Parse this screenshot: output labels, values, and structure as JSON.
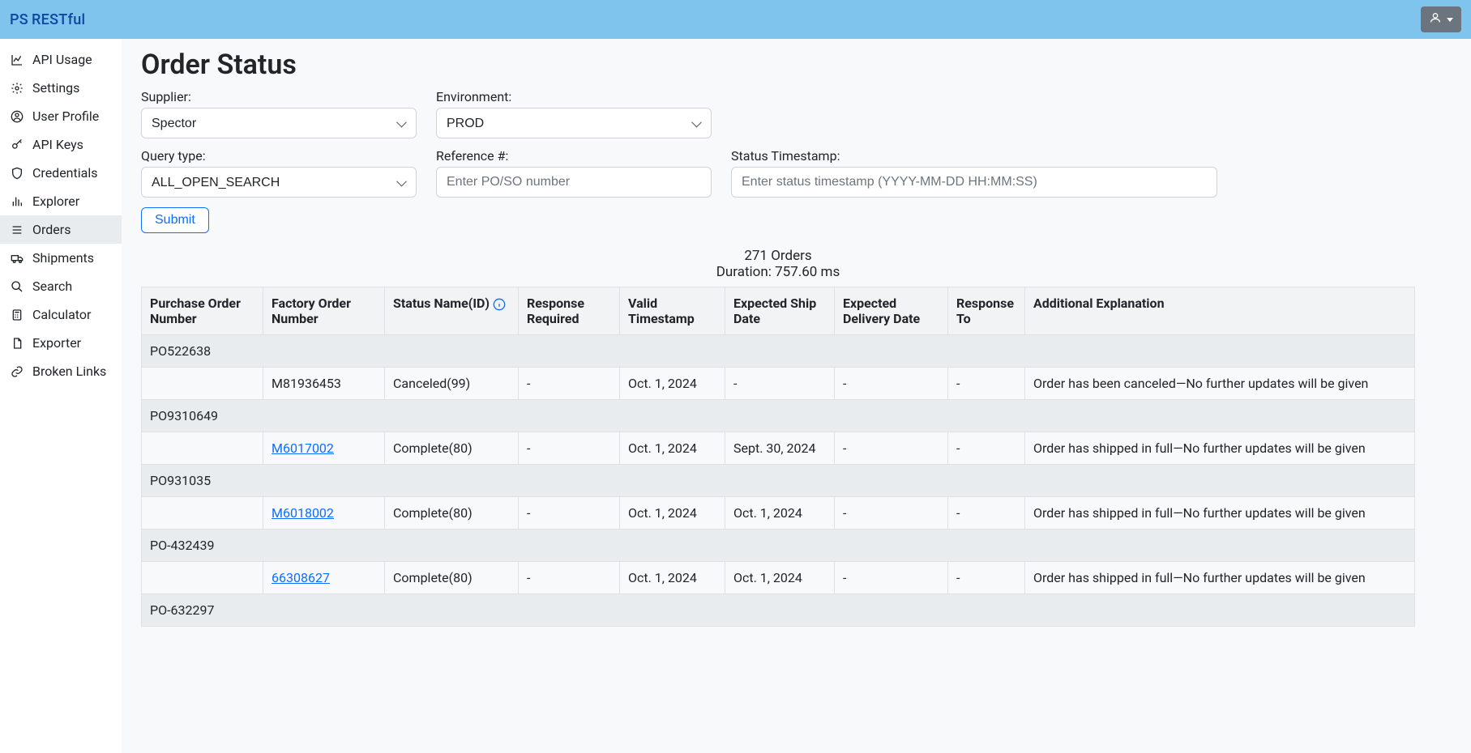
{
  "brand": {
    "ps": "PS",
    "rest": "RESTful"
  },
  "sidebar": {
    "items": [
      {
        "label": "API Usage"
      },
      {
        "label": "Settings"
      },
      {
        "label": "User Profile"
      },
      {
        "label": "API Keys"
      },
      {
        "label": "Credentials"
      },
      {
        "label": "Explorer"
      },
      {
        "label": "Orders"
      },
      {
        "label": "Shipments"
      },
      {
        "label": "Search"
      },
      {
        "label": "Calculator"
      },
      {
        "label": "Exporter"
      },
      {
        "label": "Broken Links"
      }
    ]
  },
  "page": {
    "title": "Order Status",
    "supplier_label": "Supplier:",
    "supplier_value": "Spector",
    "env_label": "Environment:",
    "env_value": "PROD",
    "query_label": "Query type:",
    "query_value": "ALL_OPEN_SEARCH",
    "ref_label": "Reference #:",
    "ref_placeholder": "Enter PO/SO number",
    "ts_label": "Status Timestamp:",
    "ts_placeholder": "Enter status timestamp (YYYY-MM-DD HH:MM:SS)",
    "submit": "Submit"
  },
  "results": {
    "count_text": "271 Orders",
    "duration_text": "Duration: 757.60 ms"
  },
  "table": {
    "headers": {
      "po": "Purchase Order Number",
      "fon": "Factory Order Number",
      "status": "Status Name(ID)",
      "resp_req": "Response Required",
      "valid_ts": "Valid Timestamp",
      "exp_ship": "Expected Ship Date",
      "exp_deliv": "Expected Delivery Date",
      "resp_to": "Response To",
      "explain": "Additional Explanation"
    },
    "groups": [
      {
        "po": "PO522638",
        "row": {
          "fon": "M81936453",
          "fon_link": false,
          "status": "Canceled(99)",
          "resp_req": "-",
          "valid_ts": "Oct. 1, 2024",
          "exp_ship": "-",
          "exp_deliv": "-",
          "resp_to": "-",
          "explain": "Order has been canceled—No further updates will be given"
        }
      },
      {
        "po": "PO9310649",
        "row": {
          "fon": "M6017002",
          "fon_link": true,
          "status": "Complete(80)",
          "resp_req": "-",
          "valid_ts": "Oct. 1, 2024",
          "exp_ship": "Sept. 30, 2024",
          "exp_deliv": "-",
          "resp_to": "-",
          "explain": "Order has shipped in full—No further updates will be given"
        }
      },
      {
        "po": "PO931035",
        "row": {
          "fon": "M6018002",
          "fon_link": true,
          "status": "Complete(80)",
          "resp_req": "-",
          "valid_ts": "Oct. 1, 2024",
          "exp_ship": "Oct. 1, 2024",
          "exp_deliv": "-",
          "resp_to": "-",
          "explain": "Order has shipped in full—No further updates will be given"
        }
      },
      {
        "po": "PO-432439",
        "row": {
          "fon": "66308627",
          "fon_link": true,
          "status": "Complete(80)",
          "resp_req": "-",
          "valid_ts": "Oct. 1, 2024",
          "exp_ship": "Oct. 1, 2024",
          "exp_deliv": "-",
          "resp_to": "-",
          "explain": "Order has shipped in full—No further updates will be given"
        }
      },
      {
        "po": "PO-632297",
        "row": null
      }
    ]
  }
}
